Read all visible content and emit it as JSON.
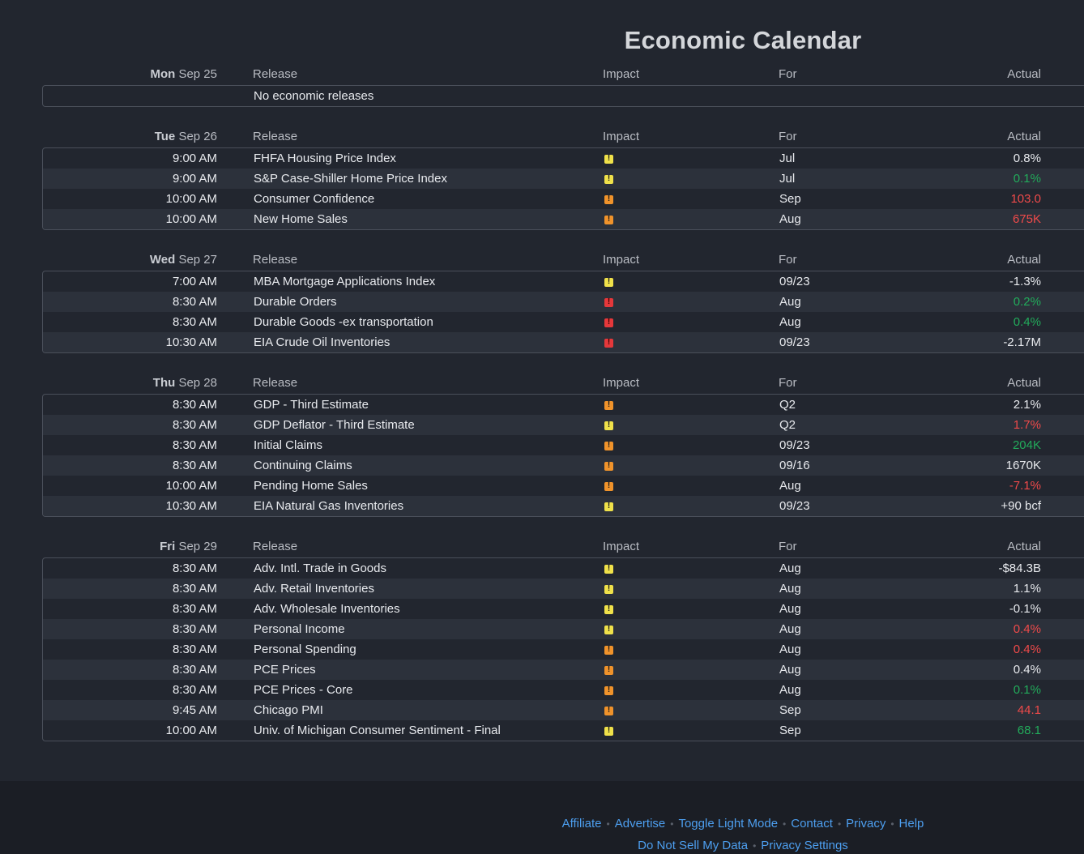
{
  "page": {
    "title": "Economic Calendar"
  },
  "columns": {
    "release": "Release",
    "impact": "Impact",
    "for": "For",
    "actual": "Actual"
  },
  "days": [
    {
      "dow": "Mon",
      "date": "Sep 25",
      "empty_text": "No economic releases",
      "rows": []
    },
    {
      "dow": "Tue",
      "date": "Sep 26",
      "rows": [
        {
          "time": "9:00 AM",
          "release": "FHFA Housing Price Index",
          "impact": "low",
          "for": "Jul",
          "actual": "0.8%",
          "trend": "neutral"
        },
        {
          "time": "9:00 AM",
          "release": "S&P Case-Shiller Home Price Index",
          "impact": "low",
          "for": "Jul",
          "actual": "0.1%",
          "trend": "up"
        },
        {
          "time": "10:00 AM",
          "release": "Consumer Confidence",
          "impact": "medium",
          "for": "Sep",
          "actual": "103.0",
          "trend": "down"
        },
        {
          "time": "10:00 AM",
          "release": "New Home Sales",
          "impact": "medium",
          "for": "Aug",
          "actual": "675K",
          "trend": "down"
        }
      ]
    },
    {
      "dow": "Wed",
      "date": "Sep 27",
      "rows": [
        {
          "time": "7:00 AM",
          "release": "MBA Mortgage Applications Index",
          "impact": "low",
          "for": "09/23",
          "actual": "-1.3%",
          "trend": "neutral"
        },
        {
          "time": "8:30 AM",
          "release": "Durable Orders",
          "impact": "high",
          "for": "Aug",
          "actual": "0.2%",
          "trend": "up"
        },
        {
          "time": "8:30 AM",
          "release": "Durable Goods -ex transportation",
          "impact": "high",
          "for": "Aug",
          "actual": "0.4%",
          "trend": "up"
        },
        {
          "time": "10:30 AM",
          "release": "EIA Crude Oil Inventories",
          "impact": "high",
          "for": "09/23",
          "actual": "-2.17M",
          "trend": "neutral"
        }
      ]
    },
    {
      "dow": "Thu",
      "date": "Sep 28",
      "rows": [
        {
          "time": "8:30 AM",
          "release": "GDP - Third Estimate",
          "impact": "medium",
          "for": "Q2",
          "actual": "2.1%",
          "trend": "neutral"
        },
        {
          "time": "8:30 AM",
          "release": "GDP Deflator - Third Estimate",
          "impact": "low",
          "for": "Q2",
          "actual": "1.7%",
          "trend": "down"
        },
        {
          "time": "8:30 AM",
          "release": "Initial Claims",
          "impact": "medium",
          "for": "09/23",
          "actual": "204K",
          "trend": "up"
        },
        {
          "time": "8:30 AM",
          "release": "Continuing Claims",
          "impact": "medium",
          "for": "09/16",
          "actual": "1670K",
          "trend": "neutral"
        },
        {
          "time": "10:00 AM",
          "release": "Pending Home Sales",
          "impact": "medium",
          "for": "Aug",
          "actual": "-7.1%",
          "trend": "down"
        },
        {
          "time": "10:30 AM",
          "release": "EIA Natural Gas Inventories",
          "impact": "low",
          "for": "09/23",
          "actual": "+90 bcf",
          "trend": "neutral"
        }
      ]
    },
    {
      "dow": "Fri",
      "date": "Sep 29",
      "rows": [
        {
          "time": "8:30 AM",
          "release": "Adv. Intl. Trade in Goods",
          "impact": "low",
          "for": "Aug",
          "actual": "-$84.3B",
          "trend": "neutral"
        },
        {
          "time": "8:30 AM",
          "release": "Adv. Retail Inventories",
          "impact": "low",
          "for": "Aug",
          "actual": "1.1%",
          "trend": "neutral"
        },
        {
          "time": "8:30 AM",
          "release": "Adv. Wholesale Inventories",
          "impact": "low",
          "for": "Aug",
          "actual": "-0.1%",
          "trend": "neutral"
        },
        {
          "time": "8:30 AM",
          "release": "Personal Income",
          "impact": "low",
          "for": "Aug",
          "actual": "0.4%",
          "trend": "down"
        },
        {
          "time": "8:30 AM",
          "release": "Personal Spending",
          "impact": "medium",
          "for": "Aug",
          "actual": "0.4%",
          "trend": "down"
        },
        {
          "time": "8:30 AM",
          "release": "PCE Prices",
          "impact": "medium",
          "for": "Aug",
          "actual": "0.4%",
          "trend": "neutral"
        },
        {
          "time": "8:30 AM",
          "release": "PCE Prices - Core",
          "impact": "medium",
          "for": "Aug",
          "actual": "0.1%",
          "trend": "up"
        },
        {
          "time": "9:45 AM",
          "release": "Chicago PMI",
          "impact": "medium",
          "for": "Sep",
          "actual": "44.1",
          "trend": "down"
        },
        {
          "time": "10:00 AM",
          "release": "Univ. of Michigan Consumer Sentiment - Final",
          "impact": "low",
          "for": "Sep",
          "actual": "68.1",
          "trend": "up"
        }
      ]
    }
  ],
  "colors": {
    "impact_low": "#f0e14a",
    "impact_medium": "#f0932b",
    "impact_high": "#e5383b",
    "value_up": "#22ab5b",
    "value_down": "#f04a4a",
    "link": "#4d9ff0"
  },
  "footer": {
    "links_row1": [
      "Affiliate",
      "Advertise",
      "Toggle Light Mode",
      "Contact",
      "Privacy",
      "Help"
    ],
    "links_row2": [
      "Do Not Sell My Data",
      "Privacy Settings"
    ]
  }
}
